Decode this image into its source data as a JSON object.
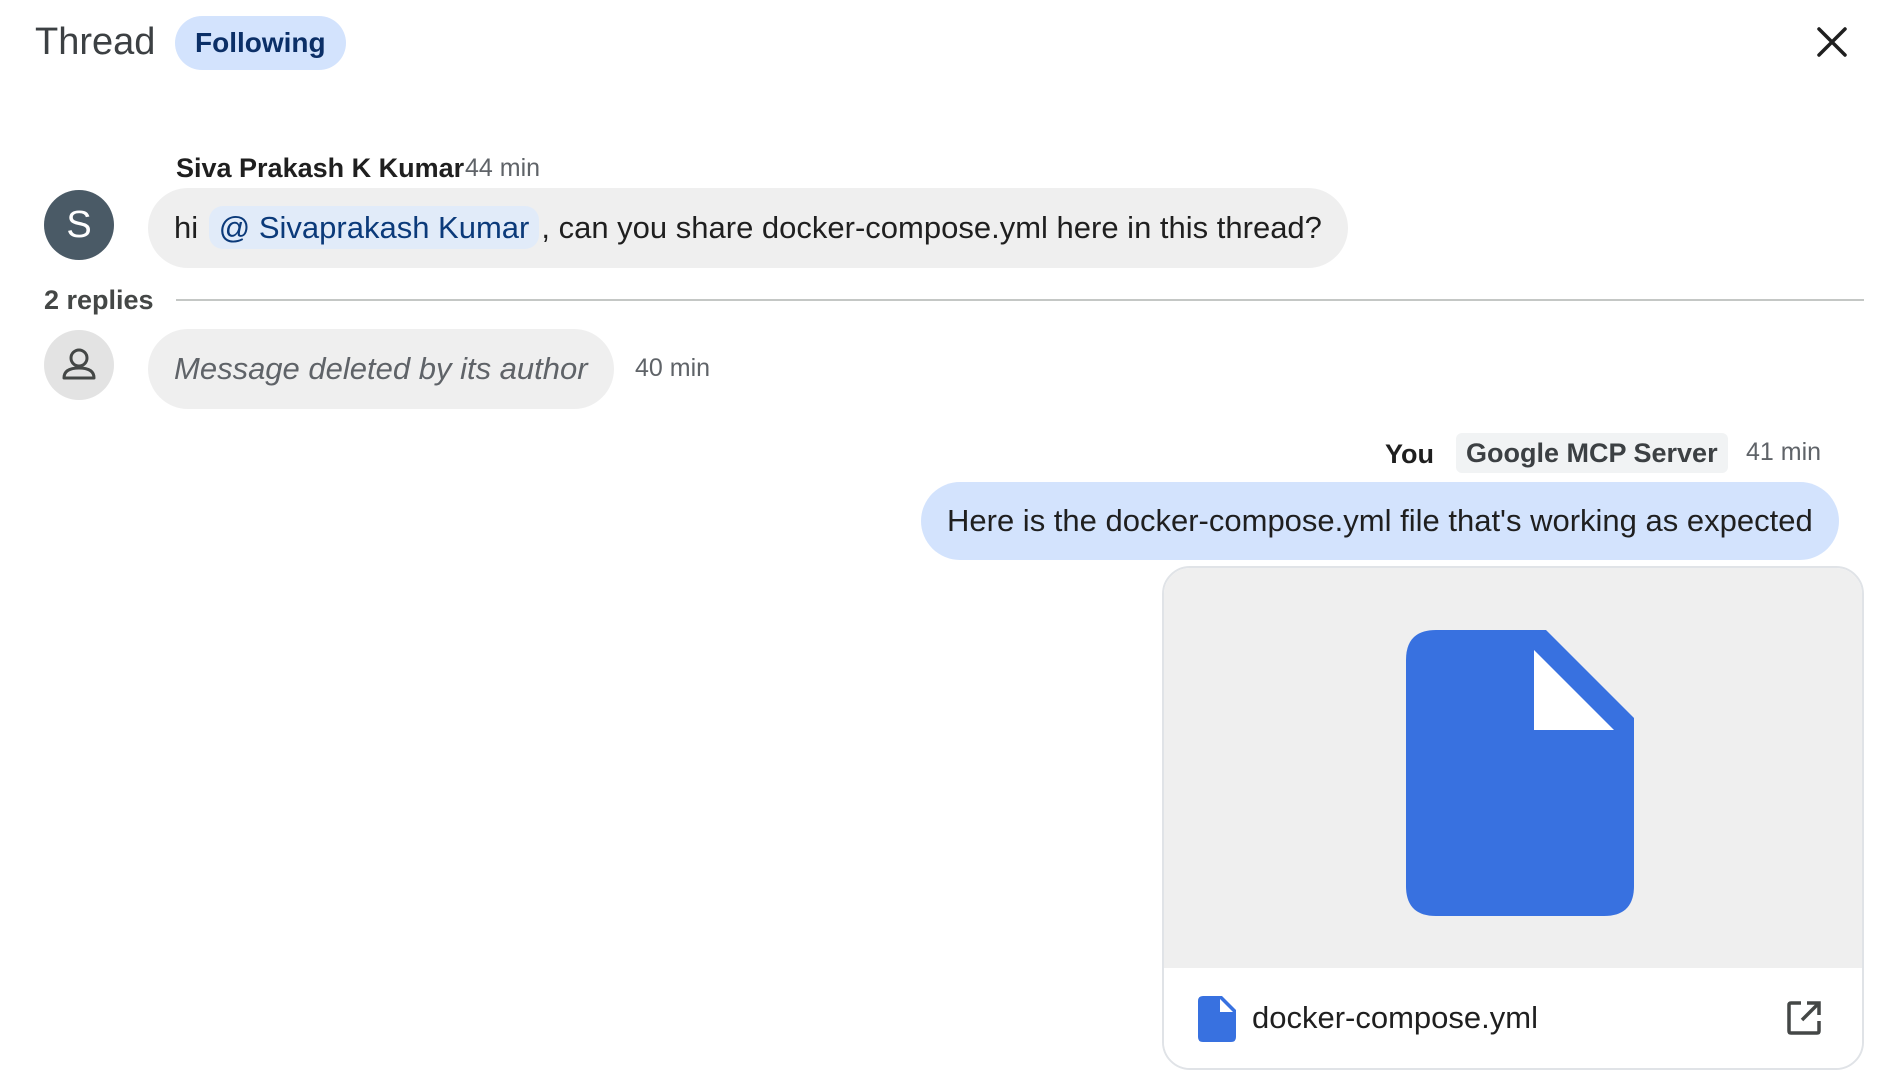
{
  "header": {
    "title": "Thread",
    "following_label": "Following",
    "close_icon": "close-icon"
  },
  "messages": [
    {
      "author": "Siva Prakash K Kumar",
      "time": "44 min",
      "avatar_letter": "S",
      "text_before": "hi",
      "mention": "@ Sivaprakash Kumar",
      "text_after": ", can you share docker-compose.yml here in this thread?"
    },
    {
      "text": "Message deleted by its author",
      "time": "40 min",
      "avatar_icon": "person-icon"
    },
    {
      "author": "You",
      "app": "Google MCP Server",
      "time": "41 min",
      "text": "Here is the docker-compose.yml file that's working as expected",
      "attachment": {
        "filename": "docker-compose.yml",
        "icon": "document-icon",
        "open_icon": "open-in-new-icon"
      }
    }
  ],
  "replies_label": "2 replies",
  "colors": {
    "accent": "#d3e3fd",
    "file_blue": "#3871e0",
    "bubble_gray": "#efefef"
  }
}
